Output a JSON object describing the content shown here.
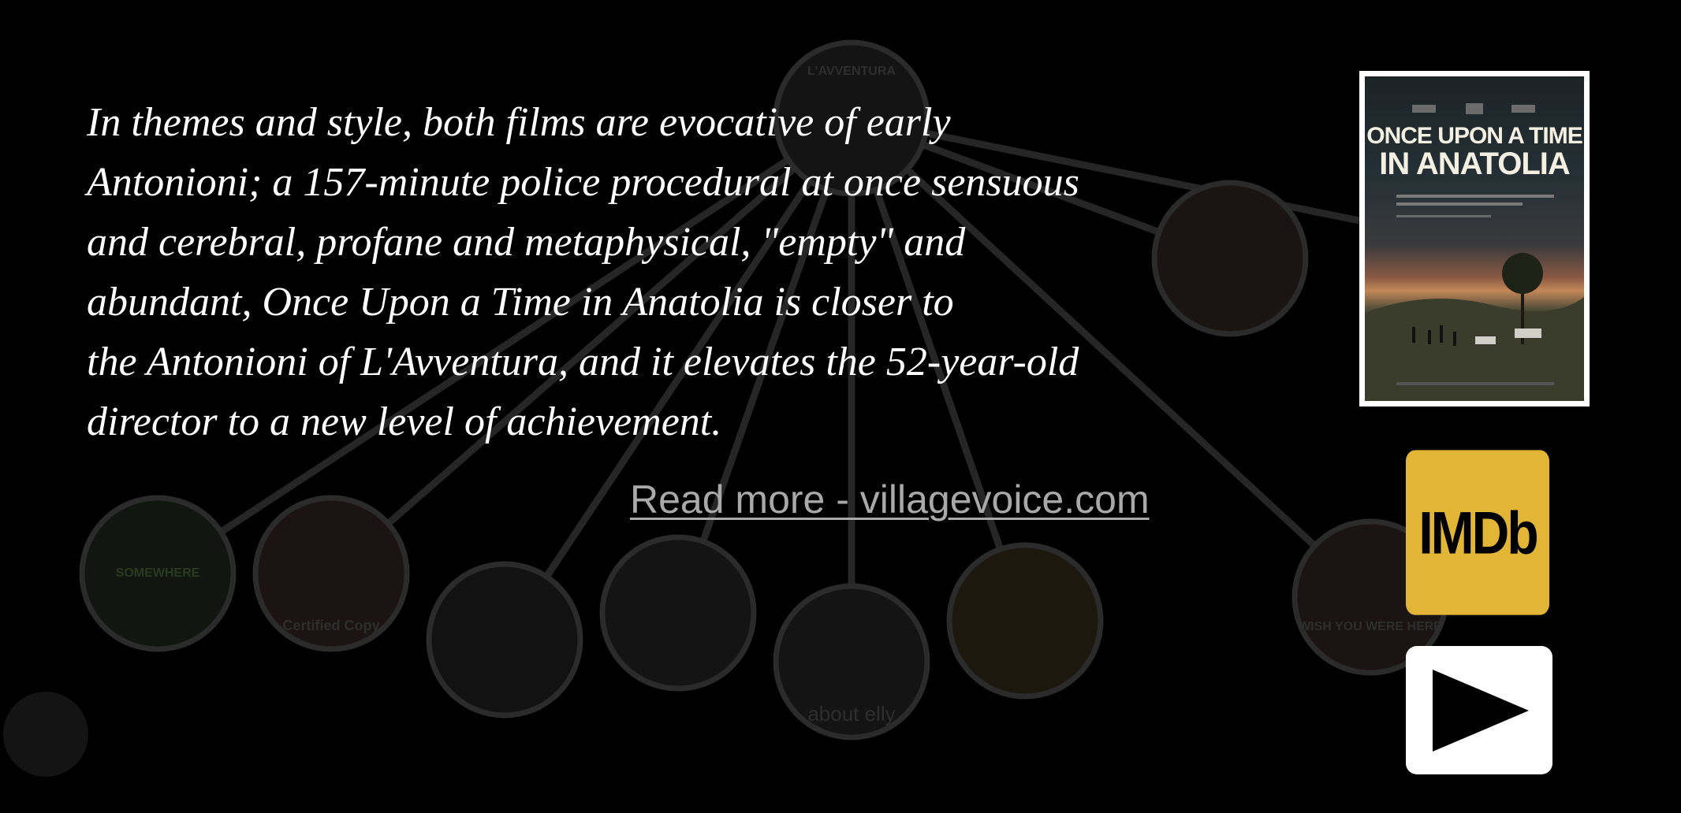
{
  "review": {
    "quote_lines": [
      "In themes and style, both films are evocative of early",
      "Antonioni; a 157-minute police procedural at once sensuous",
      "and cerebral, profane and metaphysical, \"empty\" and",
      "abundant, Once Upon a Time in Anatolia is closer to",
      "the Antonioni of L'Avventura, and it elevates the 52-year-old",
      "director to a new level of achievement."
    ],
    "read_more": "Read more - villagevoice.com"
  },
  "poster": {
    "title_line1": "ONCE UPON A TIME",
    "title_line2": "IN ANATOLIA"
  },
  "imdb": {
    "label": "IMDb"
  },
  "colors": {
    "background": "#000000",
    "text": "#ffffff",
    "link": "#a9a9a9",
    "imdb": "#e2b537",
    "graph_line": "#2a2a2a"
  },
  "graph": {
    "node_labels": [
      "L'AVVENTURA",
      "SOMEWHERE",
      "Certified Copy",
      "about elly",
      "WISH YOU WERE HERE"
    ]
  }
}
